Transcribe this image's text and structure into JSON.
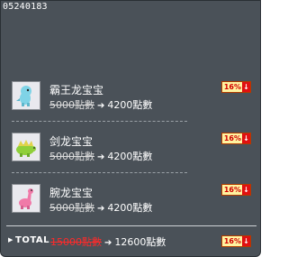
{
  "header": {
    "code": "05240183"
  },
  "items": [
    {
      "name": "霸王龙宝宝",
      "old_price": "5000點數",
      "new_price": "4200點數",
      "discount": "16%",
      "icon": "dino-blue-icon"
    },
    {
      "name": "剑龙宝宝",
      "old_price": "5000點數",
      "new_price": "4200點數",
      "discount": "16%",
      "icon": "dino-green-icon"
    },
    {
      "name": "腕龙宝宝",
      "old_price": "5000點數",
      "new_price": "4200點數",
      "discount": "16%",
      "icon": "dino-pink-icon"
    }
  ],
  "total": {
    "label": "TOTAL",
    "old_price": "15000點數",
    "new_price": "12600點數",
    "discount": "16%"
  },
  "colors": {
    "panel": "#4a5158",
    "discount_red": "#d10000",
    "badge_bg": "#fff3a0"
  }
}
